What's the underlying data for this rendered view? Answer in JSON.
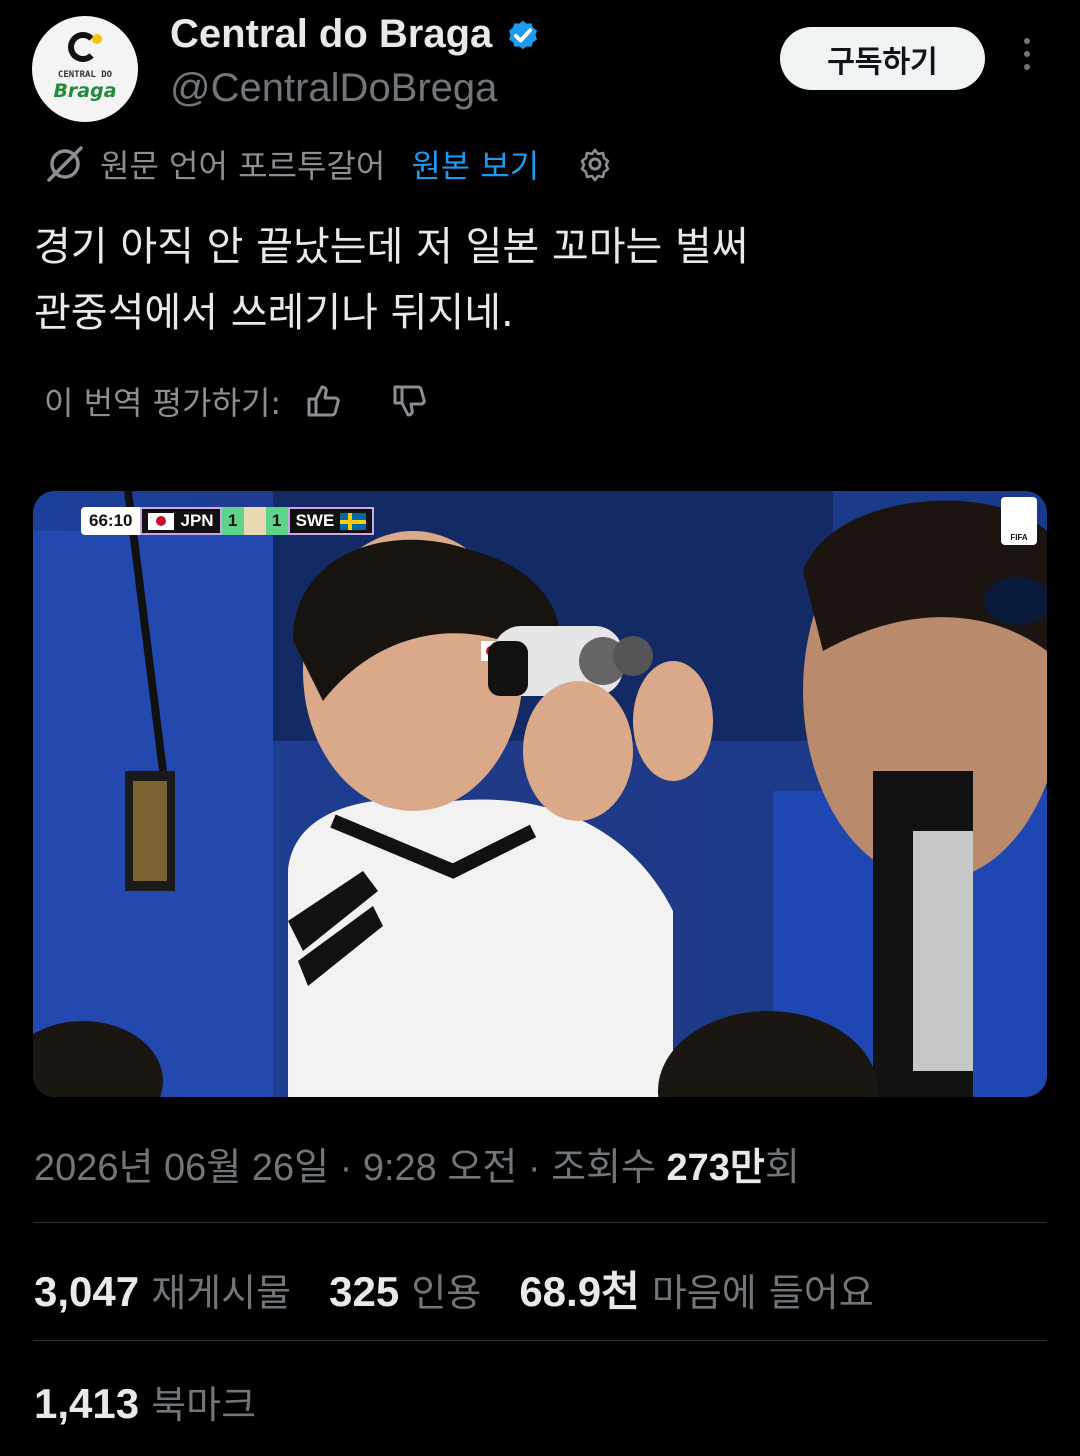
{
  "author": {
    "display_name": "Central do Braga",
    "handle": "@CentralDoBrega",
    "verified": true,
    "avatar_text_small": "CENTRAL DO",
    "avatar_text_brand": "Braga"
  },
  "header": {
    "subscribe_label": "구독하기",
    "more_icon": "more-vertical-icon"
  },
  "translation": {
    "source_label": "원문 언어 포르투갈어",
    "view_original_label": "원본 보기",
    "translate_icon": "translate-icon",
    "settings_icon": "gear-icon"
  },
  "tweet": {
    "line1": "경기 아직 안 끝났는데 저 일본 꼬마는 벌써",
    "line2": "관중석에서 쓰레기나 뒤지네."
  },
  "rating": {
    "label": "이 번역 평가하기:",
    "up_icon": "thumbs-up-icon",
    "down_icon": "thumbs-down-icon"
  },
  "media": {
    "scorebug": {
      "time": "66:10",
      "team1": "JPN",
      "score1": "1",
      "score2": "1",
      "team2": "SWE"
    },
    "badge": "FIFA"
  },
  "meta": {
    "date": "2026년 06월 26일",
    "sep1": " · ",
    "time": "9:28 오전",
    "sep2": " · ",
    "views_label": "조회수 ",
    "views_value": "273만",
    "views_suffix": "회"
  },
  "stats": {
    "reposts_value": "3,047",
    "reposts_label": "재게시물",
    "quotes_value": "325",
    "quotes_label": "인용",
    "likes_value": "68.9천",
    "likes_label": "마음에 들어요",
    "bookmarks_value": "1,413",
    "bookmarks_label": "북마크"
  },
  "colors": {
    "background": "#000000",
    "text_primary": "#e7e9ea",
    "text_secondary": "#71767b",
    "link": "#1d9bf0",
    "verified": "#1d9bf0",
    "divider": "#2f3336"
  }
}
